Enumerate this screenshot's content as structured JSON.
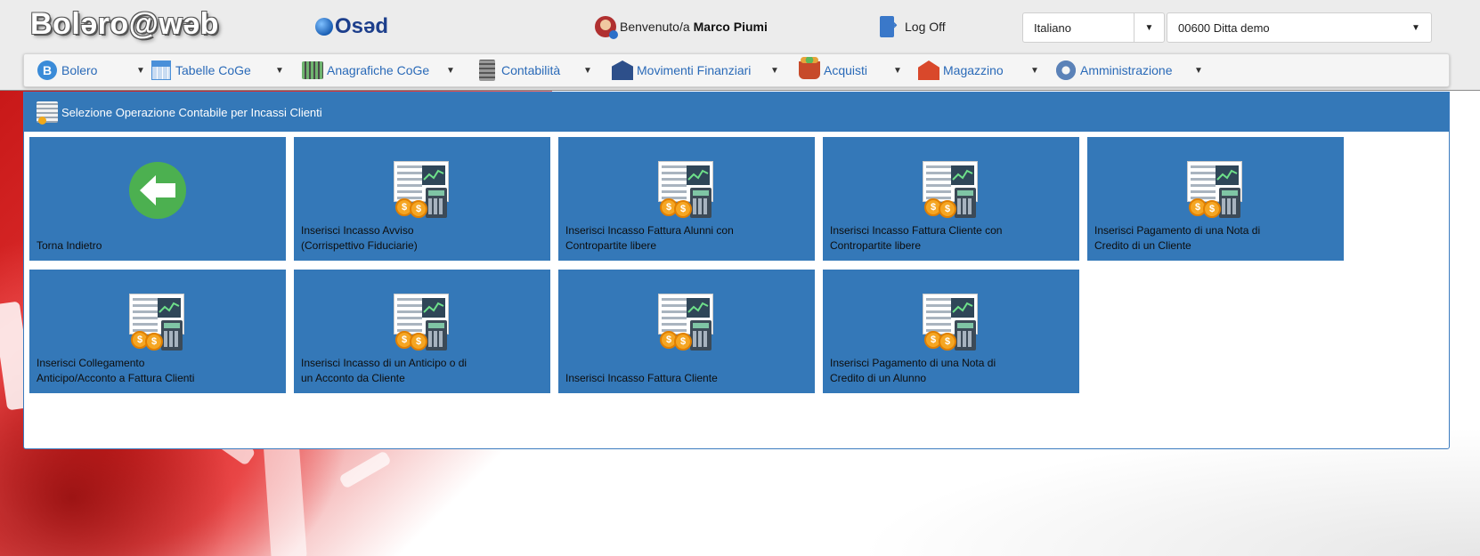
{
  "header": {
    "app_logo": "Bolərο@wəb",
    "brand": "Osəd",
    "welcome_prefix": "Benvenuto/a",
    "user_name": "Marco Piumi",
    "logoff_label": "Log Off",
    "language_select": "Italiano",
    "company_select": "00600 Ditta demo"
  },
  "menu": {
    "items": [
      {
        "label": "Bolero",
        "icon": "bolero-b-icon"
      },
      {
        "label": "Tabelle CoGe",
        "icon": "calendar-table-icon"
      },
      {
        "label": "Anagrafiche CoGe",
        "icon": "keyboard-icon"
      },
      {
        "label": "Contabilità",
        "icon": "calculator-icon"
      },
      {
        "label": "Movimenti Finanziari",
        "icon": "bank-icon"
      },
      {
        "label": "Acquisti",
        "icon": "shopping-cart-icon"
      },
      {
        "label": "Magazzino",
        "icon": "warehouse-icon"
      },
      {
        "label": "Amministrazione",
        "icon": "gear-icon"
      }
    ]
  },
  "panel": {
    "title": "Selezione Operazione Contabile per Incassi Clienti",
    "tiles": [
      {
        "label": "Torna Indietro",
        "icon": "back-arrow-icon"
      },
      {
        "label": "Inserisci Incasso Avviso (Corrispettivo Fiduciarie)",
        "icon": "accounting-icon"
      },
      {
        "label": "Inserisci Incasso Fattura Alunni con Contropartite libere",
        "icon": "accounting-icon"
      },
      {
        "label": "Inserisci Incasso Fattura Cliente con Contropartite libere",
        "icon": "accounting-icon"
      },
      {
        "label": "Inserisci Pagamento di una Nota di Credito di un Cliente",
        "icon": "accounting-icon"
      },
      {
        "label": "Inserisci Collegamento Anticipo/Acconto a Fattura Clienti",
        "icon": "accounting-icon"
      },
      {
        "label": "Inserisci Incasso di un Anticipo o di un Acconto da Cliente",
        "icon": "accounting-icon"
      },
      {
        "label": "Inserisci Incasso Fattura Cliente",
        "icon": "accounting-icon"
      },
      {
        "label": "Inserisci Pagamento di una Nota di Credito di un Alunno",
        "icon": "accounting-icon"
      }
    ]
  },
  "colors": {
    "accent": "#3478b8",
    "menu_text": "#2a6ab8",
    "back_arrow": "#4cb050"
  }
}
